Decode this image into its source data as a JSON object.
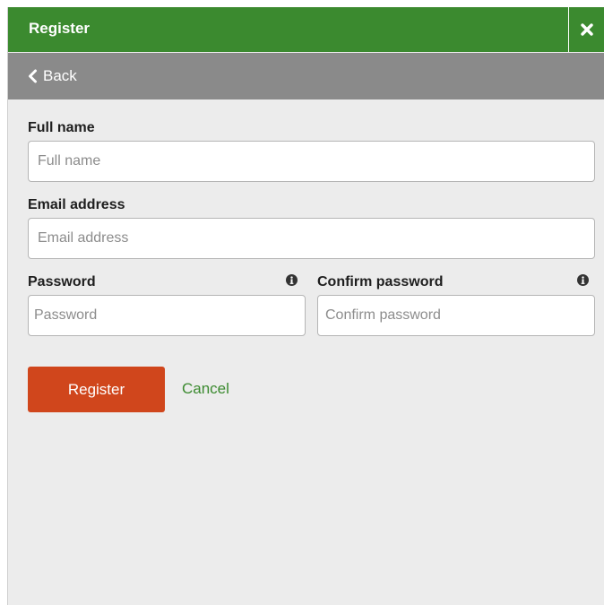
{
  "header": {
    "title": "Register",
    "close_icon": "close-icon",
    "bg_color": "#3b8a2f"
  },
  "nav": {
    "back_label": "Back",
    "back_icon": "chevron-left-icon"
  },
  "form": {
    "full_name": {
      "label": "Full name",
      "placeholder": "Full name",
      "value": ""
    },
    "email": {
      "label": "Email address",
      "placeholder": "Email address",
      "value": ""
    },
    "password": {
      "label": "Password",
      "placeholder": "Password",
      "value": "",
      "info_icon": "info-icon"
    },
    "confirm_password": {
      "label": "Confirm password",
      "placeholder": "Confirm password",
      "value": "",
      "info_icon": "info-icon"
    }
  },
  "actions": {
    "register_label": "Register",
    "cancel_label": "Cancel",
    "register_color": "#d0461c",
    "cancel_color": "#3b8a2f"
  }
}
